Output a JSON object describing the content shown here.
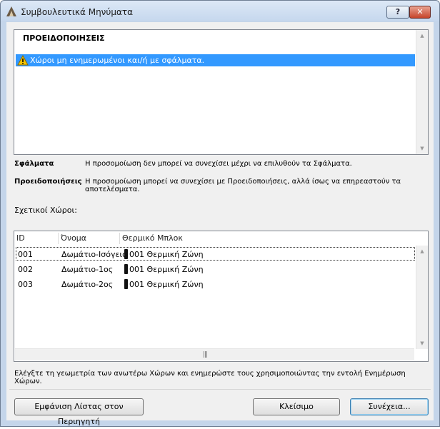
{
  "window": {
    "title": "Συμβουλευτικά Μηνύματα",
    "help_label": "?",
    "close_label": "✕"
  },
  "messages": {
    "group_header": "ΠΡΟΕΙΔΟΠΟΙΗΣΕΙΣ",
    "selected_item": "Χώροι μη ενημερωμένοι και/ή με σφάλματα."
  },
  "legend": {
    "errors_term": "Σφάλματα",
    "errors_desc": "Η προσομοίωση δεν μπορεί να συνεχίσει μέχρι να επιλυθούν τα Σφάλματα.",
    "warnings_term": "Προειδοποιήσεις",
    "warnings_desc": "Η προσομοίωση μπορεί να συνεχίσει με Προειδοποιήσεις, αλλά ίσως να επηρεαστούν τα αποτελέσματα."
  },
  "related_label": "Σχετικοί Χώροι:",
  "table": {
    "columns": [
      "ID",
      "Όνομα",
      "Θερμικό Μπλοκ"
    ],
    "rows": [
      {
        "id": "001",
        "name": "Δωμάτιο-Ισόγειο",
        "block": "001 Θερμική Ζώνη"
      },
      {
        "id": "002",
        "name": "Δωμάτιο-1ος",
        "block": "001 Θερμική Ζώνη"
      },
      {
        "id": "003",
        "name": "Δωμάτιο-2ος",
        "block": "001 Θερμική Ζώνη"
      }
    ],
    "block_swatch_color": "#111111"
  },
  "hint": "Ελέγξτε τη γεωμετρία των ανωτέρω Χώρων και ενημερώστε τους χρησιμοποιώντας την εντολή Ενημέρωση Χώρων.",
  "buttons": {
    "show_list": "Εμφάνιση Λίστας στον Περιηγητή",
    "close": "Κλείσιμο",
    "continue": "Συνέχεια..."
  },
  "colors": {
    "selection": "#3399ff",
    "warning_icon": "#f5c400"
  },
  "icons": {
    "app": "archicad-icon",
    "warning": "warning-triangle-icon",
    "help": "help-icon",
    "close": "close-icon"
  }
}
